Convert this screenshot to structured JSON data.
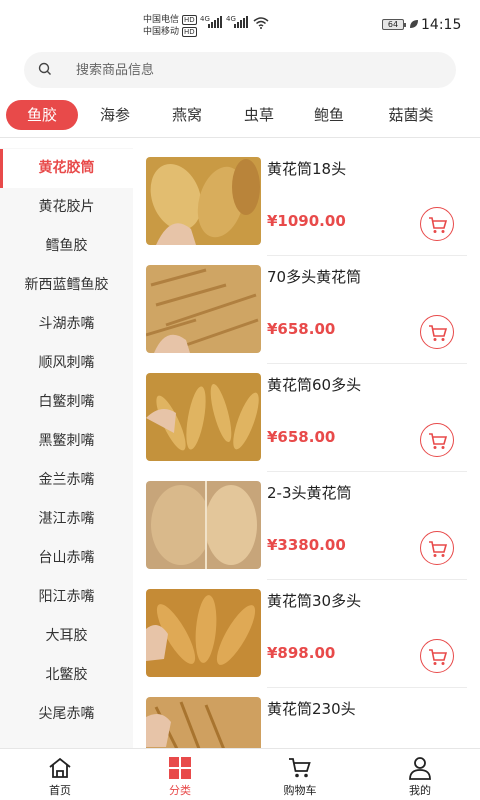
{
  "status_bar": {
    "carrier1": "中国电信",
    "carrier2": "中国移动",
    "hd": "HD",
    "net1": "4G",
    "net2": "4G",
    "battery": "64",
    "time": "14:15"
  },
  "search": {
    "placeholder": "搜索商品信息"
  },
  "top_tabs": [
    {
      "label": "鱼胶",
      "active": true
    },
    {
      "label": "海参"
    },
    {
      "label": "燕窝"
    },
    {
      "label": "虫草"
    },
    {
      "label": "鲍鱼"
    },
    {
      "label": "菇菌类"
    }
  ],
  "sidebar": [
    {
      "label": "黄花胶筒",
      "active": true
    },
    {
      "label": "黄花胶片"
    },
    {
      "label": "鳕鱼胶"
    },
    {
      "label": "新西蓝鳕鱼胶"
    },
    {
      "label": "斗湖赤嘴"
    },
    {
      "label": "顺风刺嘴"
    },
    {
      "label": "白鳘刺嘴"
    },
    {
      "label": "黑鳘刺嘴"
    },
    {
      "label": "金兰赤嘴"
    },
    {
      "label": "湛江赤嘴"
    },
    {
      "label": "台山赤嘴"
    },
    {
      "label": "阳江赤嘴"
    },
    {
      "label": "大耳胶"
    },
    {
      "label": "北鳘胶"
    },
    {
      "label": "尖尾赤嘴"
    },
    {
      "label": ""
    }
  ],
  "products": [
    {
      "name": "黄花筒18头",
      "price": "¥1090.00",
      "img_color": "#c99a44"
    },
    {
      "name": "70多头黄花筒",
      "price": "¥658.00",
      "img_color": "#cfa564"
    },
    {
      "name": "黄花筒60多头",
      "price": "¥658.00",
      "img_color": "#c4923c"
    },
    {
      "name": "2-3头黄花筒",
      "price": "¥3380.00",
      "img_color": "#c7a57a"
    },
    {
      "name": "黄花筒30多头",
      "price": "¥898.00",
      "img_color": "#c58b36"
    },
    {
      "name": "黄花筒230头",
      "price": "",
      "img_color": "#cfa060"
    }
  ],
  "bottom_nav": [
    {
      "label": "首页",
      "icon": "home-icon"
    },
    {
      "label": "分类",
      "icon": "category-icon",
      "active": true
    },
    {
      "label": "购物车",
      "icon": "cart-icon"
    },
    {
      "label": "我的",
      "icon": "user-icon"
    }
  ],
  "colors": {
    "accent": "#e84a4a"
  }
}
